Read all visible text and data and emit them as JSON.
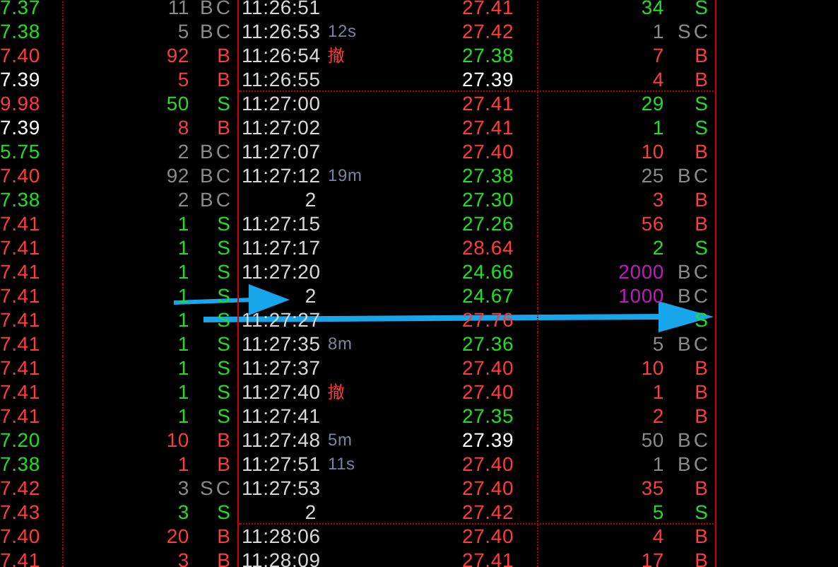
{
  "rows": [
    {
      "left": {
        "price": {
          "text": "7.37",
          "color": "#1ee01e"
        },
        "volume": {
          "text": "11",
          "color": "#8a8a8a"
        },
        "side": {
          "text": "BC",
          "color": "#8a8a8a"
        }
      },
      "time": "11:26:51",
      "right": {
        "price": {
          "text": "27.41",
          "color": "#ff3b3b"
        },
        "volume": {
          "text": "34",
          "color": "#1ee01e"
        },
        "side": {
          "text": "S",
          "color": "#1ee01e"
        }
      }
    },
    {
      "left": {
        "price": {
          "text": "7.38",
          "color": "#1ee01e"
        },
        "volume": {
          "text": "5",
          "color": "#8a8a8a"
        },
        "side": {
          "text": "BC",
          "color": "#8a8a8a"
        }
      },
      "time": "11:26:53",
      "note": {
        "text": "12s",
        "color": "#7585a0"
      },
      "right": {
        "price": {
          "text": "27.42",
          "color": "#ff3b3b"
        },
        "volume": {
          "text": "1",
          "color": "#8a8a8a"
        },
        "side": {
          "text": "SC",
          "color": "#8a8a8a"
        }
      }
    },
    {
      "left": {
        "price": {
          "text": "7.40",
          "color": "#ff3b3b"
        },
        "volume": {
          "text": "92",
          "color": "#ff3b3b"
        },
        "side": {
          "text": "B",
          "color": "#ff3b3b"
        }
      },
      "time": "11:26:54",
      "note": {
        "text": "撤",
        "color": "#ff3b3b"
      },
      "right": {
        "price": {
          "text": "27.38",
          "color": "#1ee01e"
        },
        "volume": {
          "text": "7",
          "color": "#ff3b3b"
        },
        "side": {
          "text": "B",
          "color": "#ff3b3b"
        }
      }
    },
    {
      "left": {
        "price": {
          "text": "7.39",
          "color": "#ffffff"
        },
        "volume": {
          "text": "5",
          "color": "#ff3b3b"
        },
        "side": {
          "text": "B",
          "color": "#ff3b3b"
        }
      },
      "time": "11:26:55",
      "divider_after": true,
      "right": {
        "price": {
          "text": "27.39",
          "color": "#ffffff"
        },
        "volume": {
          "text": "4",
          "color": "#ff3b3b"
        },
        "side": {
          "text": "B",
          "color": "#ff3b3b"
        }
      }
    },
    {
      "left": {
        "price": {
          "text": "9.98",
          "color": "#ff3b3b"
        },
        "volume": {
          "text": "50",
          "color": "#1ee01e"
        },
        "side": {
          "text": "S",
          "color": "#1ee01e"
        }
      },
      "time": "11:27:00",
      "right": {
        "price": {
          "text": "27.41",
          "color": "#ff3b3b"
        },
        "volume": {
          "text": "29",
          "color": "#1ee01e"
        },
        "side": {
          "text": "S",
          "color": "#1ee01e"
        }
      }
    },
    {
      "left": {
        "price": {
          "text": "7.39",
          "color": "#ffffff"
        },
        "volume": {
          "text": "8",
          "color": "#ff3b3b"
        },
        "side": {
          "text": "B",
          "color": "#ff3b3b"
        }
      },
      "time": "11:27:02",
      "right": {
        "price": {
          "text": "27.41",
          "color": "#ff3b3b"
        },
        "volume": {
          "text": "1",
          "color": "#1ee01e"
        },
        "side": {
          "text": "S",
          "color": "#1ee01e"
        }
      }
    },
    {
      "left": {
        "price": {
          "text": "5.75",
          "color": "#1ee01e"
        },
        "volume": {
          "text": "2",
          "color": "#8a8a8a"
        },
        "side": {
          "text": "BC",
          "color": "#8a8a8a"
        }
      },
      "time": "11:27:07",
      "right": {
        "price": {
          "text": "27.40",
          "color": "#ff3b3b"
        },
        "volume": {
          "text": "10",
          "color": "#ff3b3b"
        },
        "side": {
          "text": "B",
          "color": "#ff3b3b"
        }
      }
    },
    {
      "left": {
        "price": {
          "text": "7.40",
          "color": "#ff3b3b"
        },
        "volume": {
          "text": "92",
          "color": "#8a8a8a"
        },
        "side": {
          "text": "BC",
          "color": "#8a8a8a"
        }
      },
      "time": "11:27:12",
      "note": {
        "text": "19m",
        "color": "#7585a0"
      },
      "right": {
        "price": {
          "text": "27.38",
          "color": "#1ee01e"
        },
        "volume": {
          "text": "25",
          "color": "#8a8a8a"
        },
        "side": {
          "text": "BC",
          "color": "#8a8a8a"
        }
      }
    },
    {
      "left": {
        "price": {
          "text": "7.38",
          "color": "#1ee01e"
        },
        "volume": {
          "text": "2",
          "color": "#8a8a8a"
        },
        "side": {
          "text": "BC",
          "color": "#8a8a8a"
        }
      },
      "count": "2",
      "right": {
        "price": {
          "text": "27.30",
          "color": "#1ee01e"
        },
        "volume": {
          "text": "3",
          "color": "#ff3b3b"
        },
        "side": {
          "text": "B",
          "color": "#ff3b3b"
        }
      }
    },
    {
      "left": {
        "price": {
          "text": "7.41",
          "color": "#ff3b3b"
        },
        "volume": {
          "text": "1",
          "color": "#1ee01e"
        },
        "side": {
          "text": "S",
          "color": "#1ee01e"
        }
      },
      "time": "11:27:15",
      "right": {
        "price": {
          "text": "27.26",
          "color": "#1ee01e"
        },
        "volume": {
          "text": "56",
          "color": "#ff3b3b"
        },
        "side": {
          "text": "B",
          "color": "#ff3b3b"
        }
      }
    },
    {
      "left": {
        "price": {
          "text": "7.41",
          "color": "#ff3b3b"
        },
        "volume": {
          "text": "1",
          "color": "#1ee01e"
        },
        "side": {
          "text": "S",
          "color": "#1ee01e"
        }
      },
      "time": "11:27:17",
      "right": {
        "price": {
          "text": "28.64",
          "color": "#ff3b3b"
        },
        "volume": {
          "text": "2",
          "color": "#1ee01e"
        },
        "side": {
          "text": "S",
          "color": "#1ee01e"
        }
      }
    },
    {
      "left": {
        "price": {
          "text": "7.41",
          "color": "#ff3b3b"
        },
        "volume": {
          "text": "1",
          "color": "#1ee01e"
        },
        "side": {
          "text": "S",
          "color": "#1ee01e"
        }
      },
      "time": "11:27:20",
      "right": {
        "price": {
          "text": "24.66",
          "color": "#1ee01e"
        },
        "volume": {
          "text": "2000",
          "color": "#c418c4"
        },
        "side": {
          "text": "BC",
          "color": "#8a8a8a"
        }
      }
    },
    {
      "left": {
        "price": {
          "text": "7.41",
          "color": "#ff3b3b"
        },
        "volume": {
          "text": "1",
          "color": "#1ee01e"
        },
        "side": {
          "text": "S",
          "color": "#1ee01e"
        }
      },
      "count": "2",
      "right": {
        "price": {
          "text": "24.67",
          "color": "#1ee01e"
        },
        "volume": {
          "text": "1000",
          "color": "#c418c4"
        },
        "side": {
          "text": "BC",
          "color": "#8a8a8a"
        }
      }
    },
    {
      "left": {
        "price": {
          "text": "7.41",
          "color": "#ff3b3b"
        },
        "volume": {
          "text": "1",
          "color": "#1ee01e"
        },
        "side": {
          "text": "S",
          "color": "#1ee01e"
        }
      },
      "time": "11:27:27",
      "right": {
        "price": {
          "text": "27.76",
          "color": "#ff3b3b"
        },
        "side": {
          "text": "S",
          "color": "#1ee01e"
        }
      }
    },
    {
      "left": {
        "price": {
          "text": "7.41",
          "color": "#ff3b3b"
        },
        "volume": {
          "text": "1",
          "color": "#1ee01e"
        },
        "side": {
          "text": "S",
          "color": "#1ee01e"
        }
      },
      "time": "11:27:35",
      "note": {
        "text": "8m",
        "color": "#7585a0"
      },
      "right": {
        "price": {
          "text": "27.36",
          "color": "#1ee01e"
        },
        "volume": {
          "text": "5",
          "color": "#8a8a8a"
        },
        "side": {
          "text": "BC",
          "color": "#8a8a8a"
        }
      }
    },
    {
      "left": {
        "price": {
          "text": "7.41",
          "color": "#ff3b3b"
        },
        "volume": {
          "text": "1",
          "color": "#1ee01e"
        },
        "side": {
          "text": "S",
          "color": "#1ee01e"
        }
      },
      "time": "11:27:37",
      "right": {
        "price": {
          "text": "27.40",
          "color": "#ff3b3b"
        },
        "volume": {
          "text": "10",
          "color": "#ff3b3b"
        },
        "side": {
          "text": "B",
          "color": "#ff3b3b"
        }
      }
    },
    {
      "left": {
        "price": {
          "text": "7.41",
          "color": "#ff3b3b"
        },
        "volume": {
          "text": "1",
          "color": "#1ee01e"
        },
        "side": {
          "text": "S",
          "color": "#1ee01e"
        }
      },
      "time": "11:27:40",
      "note": {
        "text": "撤",
        "color": "#ff3b3b"
      },
      "right": {
        "price": {
          "text": "27.40",
          "color": "#ff3b3b"
        },
        "volume": {
          "text": "1",
          "color": "#ff3b3b"
        },
        "side": {
          "text": "B",
          "color": "#ff3b3b"
        }
      }
    },
    {
      "left": {
        "price": {
          "text": "7.41",
          "color": "#ff3b3b"
        },
        "volume": {
          "text": "1",
          "color": "#1ee01e"
        },
        "side": {
          "text": "S",
          "color": "#1ee01e"
        }
      },
      "time": "11:27:41",
      "right": {
        "price": {
          "text": "27.35",
          "color": "#1ee01e"
        },
        "volume": {
          "text": "2",
          "color": "#ff3b3b"
        },
        "side": {
          "text": "B",
          "color": "#ff3b3b"
        }
      }
    },
    {
      "left": {
        "price": {
          "text": "7.20",
          "color": "#1ee01e"
        },
        "volume": {
          "text": "10",
          "color": "#ff3b3b"
        },
        "side": {
          "text": "B",
          "color": "#ff3b3b"
        }
      },
      "time": "11:27:48",
      "note": {
        "text": "5m",
        "color": "#7585a0"
      },
      "right": {
        "price": {
          "text": "27.39",
          "color": "#ffffff"
        },
        "volume": {
          "text": "50",
          "color": "#8a8a8a"
        },
        "side": {
          "text": "BC",
          "color": "#8a8a8a"
        }
      }
    },
    {
      "left": {
        "price": {
          "text": "7.38",
          "color": "#1ee01e"
        },
        "volume": {
          "text": "1",
          "color": "#ff3b3b"
        },
        "side": {
          "text": "B",
          "color": "#ff3b3b"
        }
      },
      "time": "11:27:51",
      "note": {
        "text": "11s",
        "color": "#7585a0"
      },
      "right": {
        "price": {
          "text": "27.40",
          "color": "#ff3b3b"
        },
        "volume": {
          "text": "1",
          "color": "#8a8a8a"
        },
        "side": {
          "text": "BC",
          "color": "#8a8a8a"
        }
      }
    },
    {
      "left": {
        "price": {
          "text": "7.42",
          "color": "#ff3b3b"
        },
        "volume": {
          "text": "3",
          "color": "#8a8a8a"
        },
        "side": {
          "text": "SC",
          "color": "#8a8a8a"
        }
      },
      "time": "11:27:53",
      "right": {
        "price": {
          "text": "27.40",
          "color": "#ff3b3b"
        },
        "volume": {
          "text": "35",
          "color": "#ff3b3b"
        },
        "side": {
          "text": "B",
          "color": "#ff3b3b"
        }
      }
    },
    {
      "left": {
        "price": {
          "text": "7.43",
          "color": "#ff3b3b"
        },
        "volume": {
          "text": "3",
          "color": "#1ee01e"
        },
        "side": {
          "text": "S",
          "color": "#1ee01e"
        }
      },
      "count": "2",
      "divider_after": true,
      "right": {
        "price": {
          "text": "27.42",
          "color": "#ff3b3b"
        },
        "volume": {
          "text": "5",
          "color": "#1ee01e"
        },
        "side": {
          "text": "S",
          "color": "#1ee01e"
        }
      }
    },
    {
      "left": {
        "price": {
          "text": "7.40",
          "color": "#ff3b3b"
        },
        "volume": {
          "text": "20",
          "color": "#ff3b3b"
        },
        "side": {
          "text": "B",
          "color": "#ff3b3b"
        }
      },
      "time": "11:28:06",
      "right": {
        "price": {
          "text": "27.40",
          "color": "#ff3b3b"
        },
        "volume": {
          "text": "4",
          "color": "#ff3b3b"
        },
        "side": {
          "text": "B",
          "color": "#ff3b3b"
        }
      }
    },
    {
      "left": {
        "price": {
          "text": "7.41",
          "color": "#ff3b3b"
        },
        "volume": {
          "text": "3",
          "color": "#ff3b3b"
        },
        "side": {
          "text": "B",
          "color": "#ff3b3b"
        }
      },
      "time": "11:28:09",
      "right": {
        "price": {
          "text": "27.41",
          "color": "#ff3b3b"
        },
        "volume": {
          "text": "17",
          "color": "#ff3b3b"
        },
        "side": {
          "text": "B",
          "color": "#ff3b3b"
        }
      }
    }
  ],
  "annotations": [
    {
      "kind": "arrow"
    },
    {
      "kind": "arrow"
    }
  ]
}
